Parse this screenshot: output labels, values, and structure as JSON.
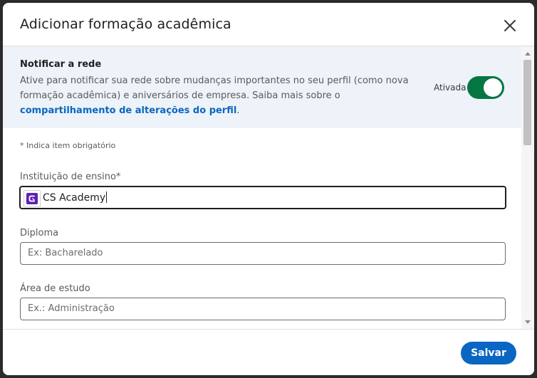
{
  "modal": {
    "title": "Adicionar formação acadêmica"
  },
  "notify": {
    "title": "Notificar a rede",
    "description": "Ative para notificar sua rede sobre mudanças importantes no seu perfil (como nova formação acadêmica) e aniversários de empresa. Saiba mais sobre o ",
    "link_text": "compartilhamento de alterações do perfil",
    "after_link": ".",
    "toggle_label": "Ativada",
    "toggle_on": true,
    "toggle_color": "#057642"
  },
  "form": {
    "required_note": "* Indica item obrigatório",
    "institution": {
      "label": "Instituição de ensino*",
      "value": "CS Academy",
      "logo_icon": "cs-academy-logo"
    },
    "degree": {
      "label": "Diploma",
      "placeholder": "Ex: Bacharelado"
    },
    "field_of_study": {
      "label": "Área de estudo",
      "placeholder": "Ex.: Administração"
    }
  },
  "footer": {
    "save_label": "Salvar"
  },
  "colors": {
    "accent": "#0a66c2",
    "notify_bg": "#edf3f8",
    "logo_purple": "#5b21b6"
  }
}
